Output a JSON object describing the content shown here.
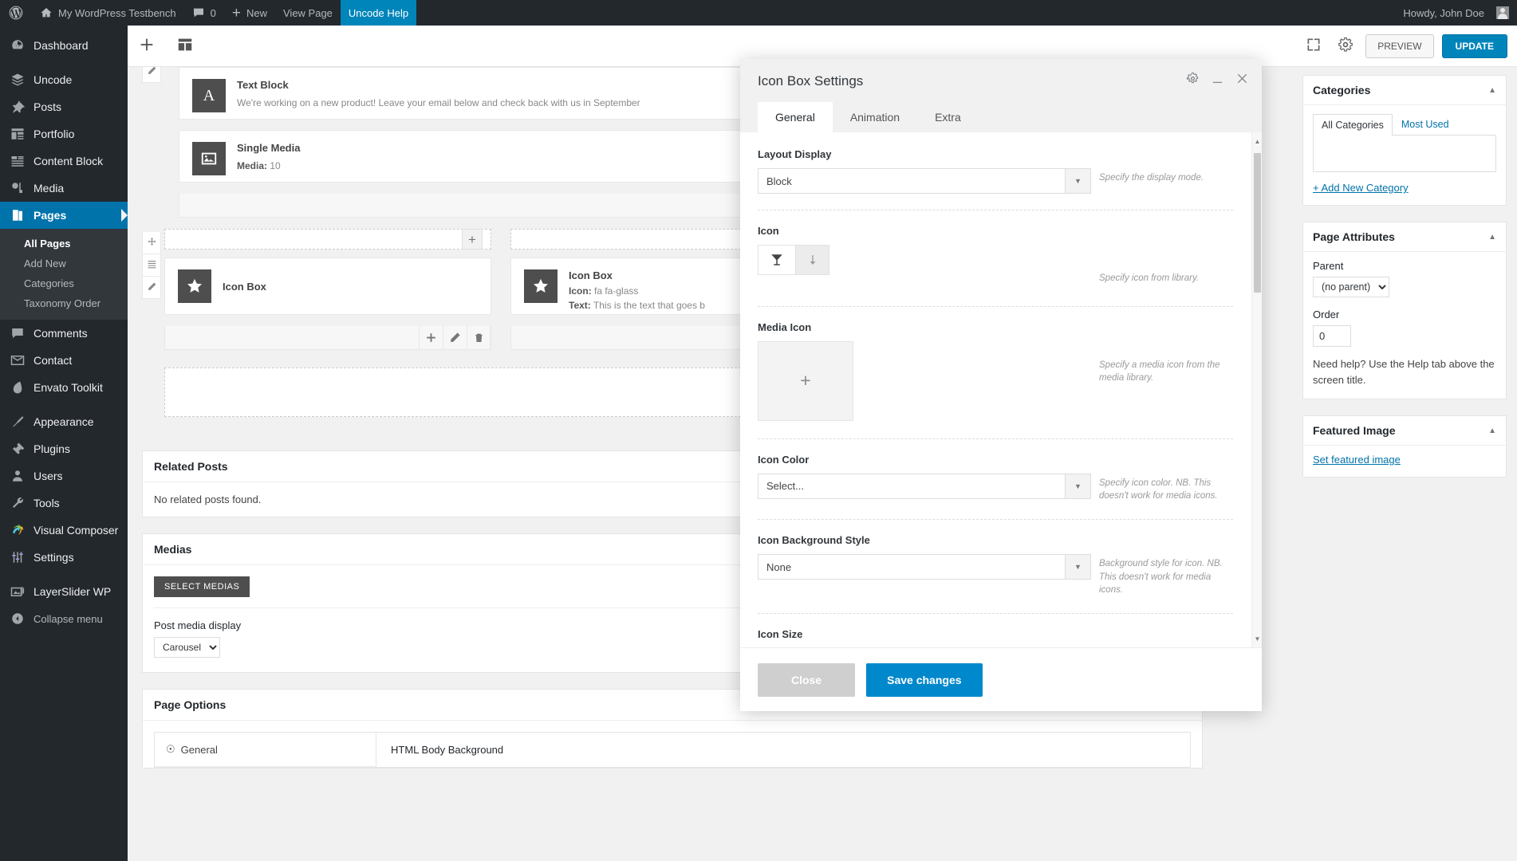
{
  "adminbar": {
    "logo_icon": "wordpress-logo-icon",
    "site_name": "My WordPress Testbench",
    "comments_count": "0",
    "new_label": "New",
    "view_page_label": "View Page",
    "help_label": "Uncode Help",
    "howdy": "Howdy, John Doe"
  },
  "sidebar": {
    "items": [
      {
        "label": "Dashboard",
        "icon": "dashboard-icon"
      },
      {
        "label": "Uncode",
        "icon": "layers-icon"
      },
      {
        "label": "Posts",
        "icon": "pin-icon"
      },
      {
        "label": "Portfolio",
        "icon": "portfolio-icon"
      },
      {
        "label": "Content Block",
        "icon": "content-block-icon"
      },
      {
        "label": "Media",
        "icon": "media-icon"
      },
      {
        "label": "Pages",
        "icon": "pages-icon"
      },
      {
        "label": "Comments",
        "icon": "comments-icon"
      },
      {
        "label": "Contact",
        "icon": "envelope-icon"
      },
      {
        "label": "Envato Toolkit",
        "icon": "envato-icon"
      },
      {
        "label": "Appearance",
        "icon": "brush-icon"
      },
      {
        "label": "Plugins",
        "icon": "plug-icon"
      },
      {
        "label": "Users",
        "icon": "users-icon"
      },
      {
        "label": "Tools",
        "icon": "wrench-icon"
      },
      {
        "label": "Visual Composer",
        "icon": "vc-icon"
      },
      {
        "label": "Settings",
        "icon": "settings-icon"
      },
      {
        "label": "LayerSlider WP",
        "icon": "slider-icon"
      },
      {
        "label": "Collapse menu",
        "icon": "collapse-icon"
      }
    ],
    "pages_submenu": [
      {
        "label": "All Pages",
        "current": true
      },
      {
        "label": "Add New",
        "current": false
      },
      {
        "label": "Categories",
        "current": false
      },
      {
        "label": "Taxonomy Order",
        "current": false
      }
    ]
  },
  "editor_toolbar": {
    "add_element_icon": "plus-icon",
    "templates_icon": "layout-icon",
    "fullscreen_icon": "expand-icon",
    "settings_icon": "gear-icon",
    "preview_label": "PREVIEW",
    "update_label": "UPDATE"
  },
  "canvas": {
    "elements": [
      {
        "name": "Text Block",
        "icon": "letter-a-icon",
        "desc_plain": "We're working on a new product! Leave your email below and check back with us in September"
      },
      {
        "name": "Single Media",
        "icon": "image-icon",
        "desc_label": "Media:",
        "desc_value": " 10"
      }
    ],
    "icon_box_left": {
      "name": "Icon Box",
      "icon": "star-icon"
    },
    "icon_box_right": {
      "name": "Icon Box",
      "icon": "star-icon",
      "line1_label": "Icon:",
      "line1_value": " fa fa-glass",
      "line2_label": "Text:",
      "line2_value": " This is the text that goes b"
    }
  },
  "metaboxes": {
    "related_posts": {
      "title": "Related Posts",
      "body": "No related posts found."
    },
    "medias": {
      "title": "Medias",
      "select_button": "SELECT MEDIAS",
      "display_label": "Post media display",
      "display_value": "Carousel"
    },
    "page_options": {
      "title": "Page Options",
      "tab_general": "General",
      "tab_general_icon": "globe-icon",
      "section_title": "HTML Body Background"
    }
  },
  "modal": {
    "title": "Icon Box Settings",
    "gear_icon": "gear-icon",
    "minimize_icon": "minimize-icon",
    "close_icon": "close-icon",
    "tabs": [
      {
        "label": "General",
        "active": true
      },
      {
        "label": "Animation",
        "active": false
      },
      {
        "label": "Extra",
        "active": false
      }
    ],
    "fields": [
      {
        "label": "Layout Display",
        "type": "select",
        "value": "Block",
        "desc": "Specify the display mode."
      },
      {
        "label": "Icon",
        "type": "iconpicker",
        "icon": "glass-icon",
        "arrow_icon": "arrow-down-icon",
        "desc": "Specify icon from library."
      },
      {
        "label": "Media Icon",
        "type": "media",
        "plus": "+",
        "desc": "Specify a media icon from the media library."
      },
      {
        "label": "Icon Color",
        "type": "select",
        "value": "Select...",
        "desc": "Specify icon color. NB. This doesn't work for media icons."
      },
      {
        "label": "Icon Background Style",
        "type": "select",
        "value": "None",
        "desc": "Background style for icon. NB. This doesn't work for media icons."
      },
      {
        "label": "Icon Size",
        "type": "partial",
        "value": "",
        "desc": ""
      }
    ],
    "footer": {
      "close_label": "Close",
      "save_label": "Save changes"
    }
  },
  "right_column": {
    "categories": {
      "title": "Categories",
      "tab_all": "All Categories",
      "tab_most_used": "Most Used",
      "add_new": "+ Add New Category"
    },
    "page_attributes": {
      "title": "Page Attributes",
      "parent_label": "Parent",
      "parent_value": "(no parent)",
      "order_label": "Order",
      "order_value": "0",
      "help": "Need help? Use the Help tab above the screen title."
    },
    "featured_image": {
      "title": "Featured Image",
      "set_link": "Set featured image"
    }
  },
  "colors": {
    "admin_dark": "#23282d",
    "admin_current": "#0073aa",
    "accent_blue": "#0085ba",
    "modal_save": "#0088cc"
  }
}
